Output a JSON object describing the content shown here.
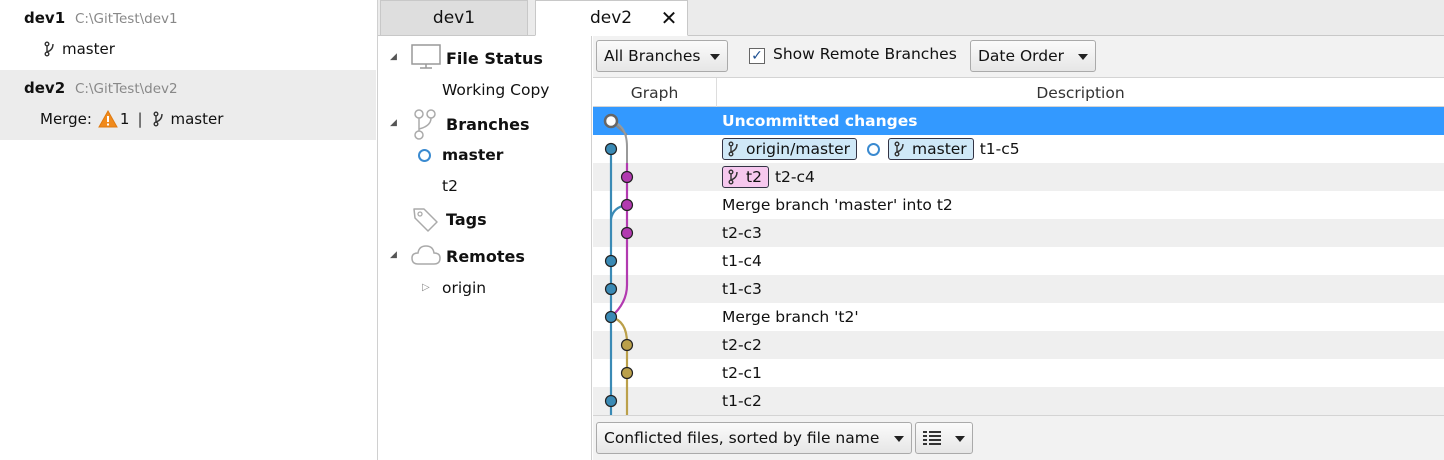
{
  "repos": [
    {
      "name": "dev1",
      "path": "C:\\GitTest\\dev1",
      "branch": "master"
    },
    {
      "name": "dev2",
      "path": "C:\\GitTest\\dev2",
      "merge_label": "Merge:",
      "merge_count": "1",
      "separator": "|",
      "branch": "master"
    }
  ],
  "tabs": [
    {
      "label": "dev1"
    },
    {
      "label": "dev2",
      "close": "✕"
    }
  ],
  "sidebar": {
    "file_status": "File Status",
    "working_copy": "Working Copy",
    "branches": "Branches",
    "branch_items": [
      "master",
      "t2"
    ],
    "tags": "Tags",
    "remotes": "Remotes",
    "remote_items": [
      "origin"
    ]
  },
  "toolbar": {
    "branches_select": "All Branches",
    "show_remote_label": "Show Remote Branches",
    "show_remote_checked": true,
    "order_select": "Date Order"
  },
  "columns": {
    "graph": "Graph",
    "description": "Description"
  },
  "commits": [
    {
      "description": "Uncommitted changes"
    },
    {
      "refs": [
        "origin/master",
        "master"
      ],
      "description": "t1-c5"
    },
    {
      "refs": [
        "t2"
      ],
      "description": "t2-c4"
    },
    {
      "description": "Merge branch 'master' into t2"
    },
    {
      "description": "t2-c3"
    },
    {
      "description": "t1-c4"
    },
    {
      "description": "t1-c3"
    },
    {
      "description": "Merge branch 't2'"
    },
    {
      "description": "t2-c2"
    },
    {
      "description": "t2-c1"
    },
    {
      "description": "t1-c2"
    }
  ],
  "bottom": {
    "sort_select": "Conflicted files, sorted by file name"
  },
  "colors": {
    "selection": "#3399ff",
    "lane_master": "#3a8ab5",
    "lane_t2": "#b23ab0",
    "lane_old_t2": "#bba04a",
    "ref_blue": "#cfe8f7",
    "ref_pink": "#f6c8ee"
  },
  "icons": {
    "branch": "branch-icon",
    "warning": "warning-icon",
    "monitor": "monitor-icon",
    "tag": "tag-icon",
    "cloud": "cloud-icon",
    "list": "list-view-icon"
  }
}
